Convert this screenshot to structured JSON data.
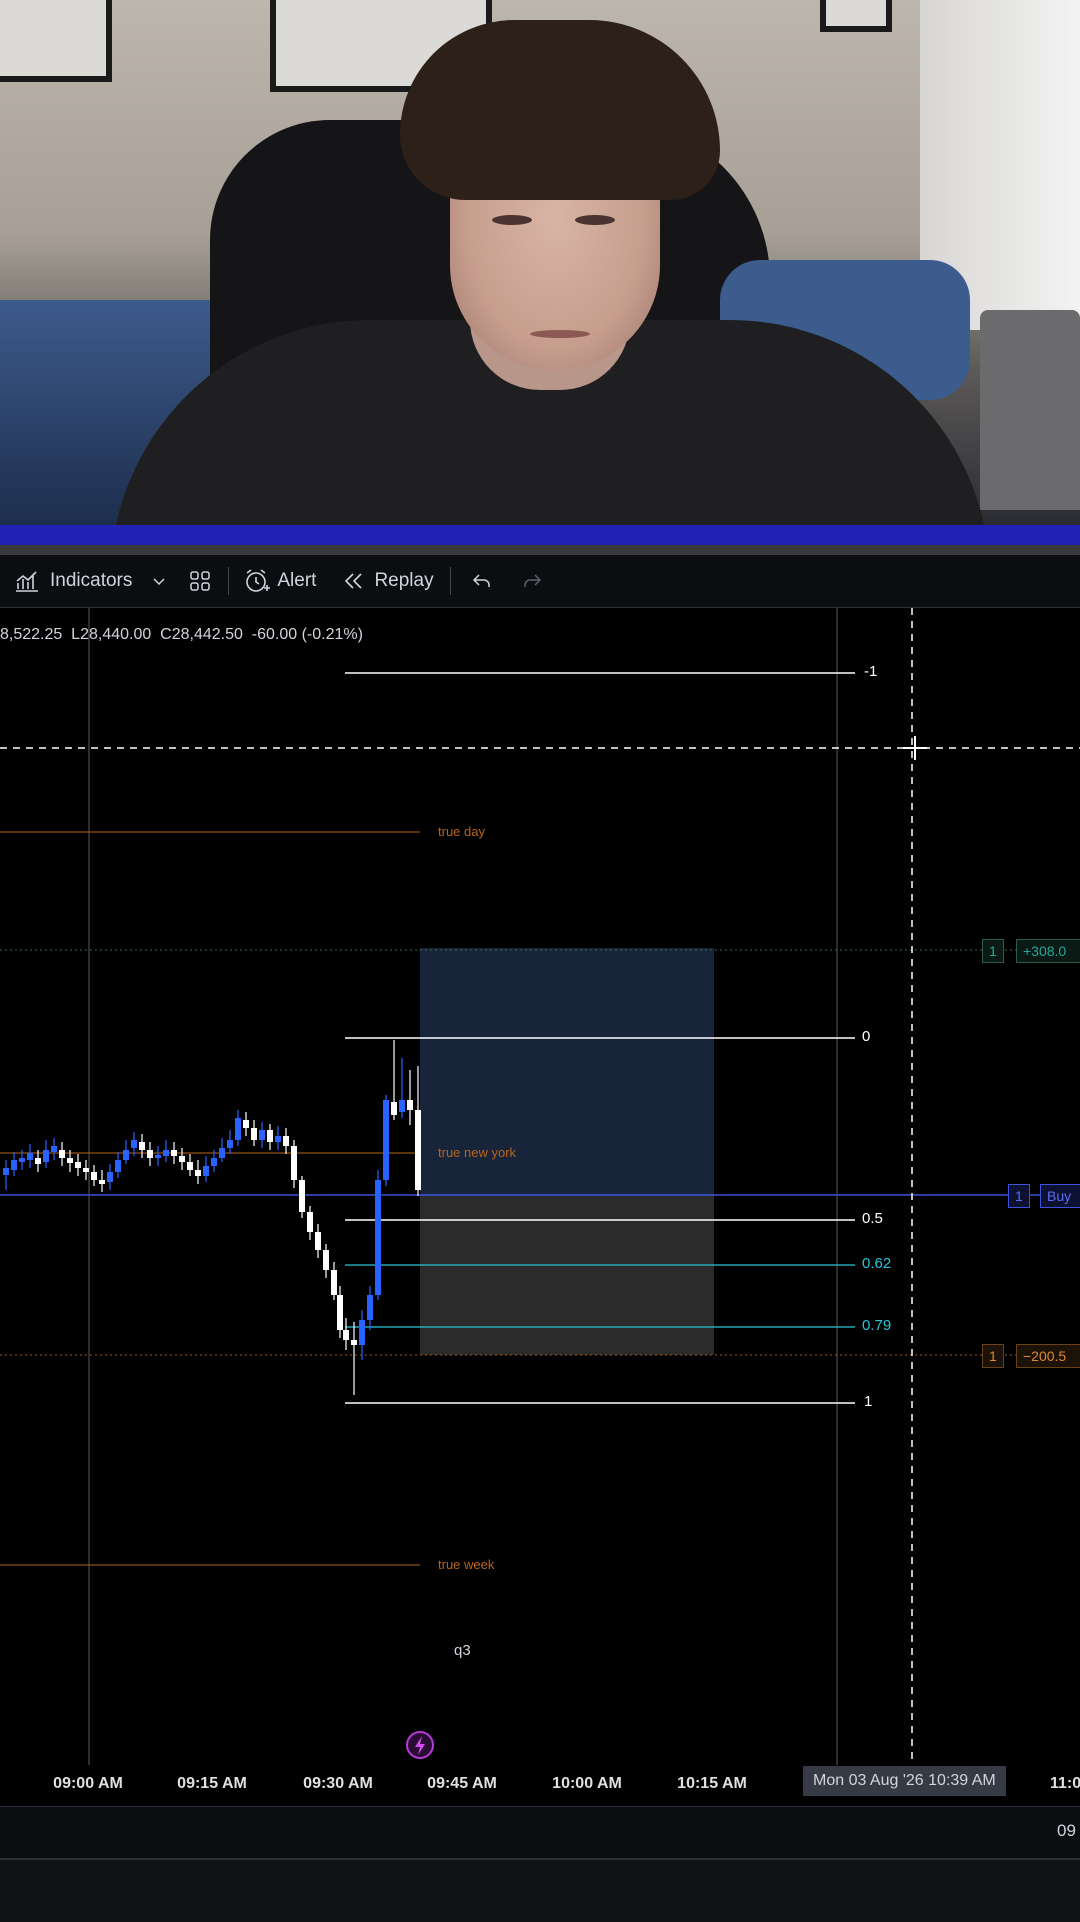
{
  "toolbar": {
    "indicators_label": "Indicators",
    "alert_label": "Alert",
    "replay_label": "Replay"
  },
  "ohlc": {
    "text": "8,522.25  L28,440.00  C28,442.50  -60.00 (-0.21%)"
  },
  "fib_levels": [
    {
      "label": "-1",
      "color": "#ffffff"
    },
    {
      "label": "0",
      "color": "#ffffff"
    },
    {
      "label": "0.5",
      "color": "#ffffff"
    },
    {
      "label": "0.62",
      "color": "#26c6da"
    },
    {
      "label": "0.79",
      "color": "#26c6da"
    },
    {
      "label": "1",
      "color": "#ffffff"
    }
  ],
  "session_labels": {
    "true_day": "true day",
    "true_new_york": "true new york",
    "true_week": "true week",
    "q3": "q3"
  },
  "order_tags": {
    "tp": {
      "qty": "1",
      "value": "+308.0"
    },
    "entry": {
      "qty": "1",
      "value": "Buy"
    },
    "sl": {
      "qty": "1",
      "value": "−200.5"
    }
  },
  "time_axis": {
    "ticks": [
      "09:00 AM",
      "09:15 AM",
      "09:30 AM",
      "09:45 AM",
      "10:00 AM",
      "10:15 AM",
      "11:0"
    ],
    "cursor_date": "Mon 03 Aug '26   10:39 AM"
  },
  "bottom_bar": {
    "right_text": "09"
  },
  "colors": {
    "bull": "#2962ff",
    "bear": "#ffffff",
    "session": "#b8641a",
    "fib_teal": "#26c6da",
    "entry_line": "#3f51d8",
    "tp_zone": "#1b2a44",
    "sl_zone": "#2b2b2b"
  }
}
